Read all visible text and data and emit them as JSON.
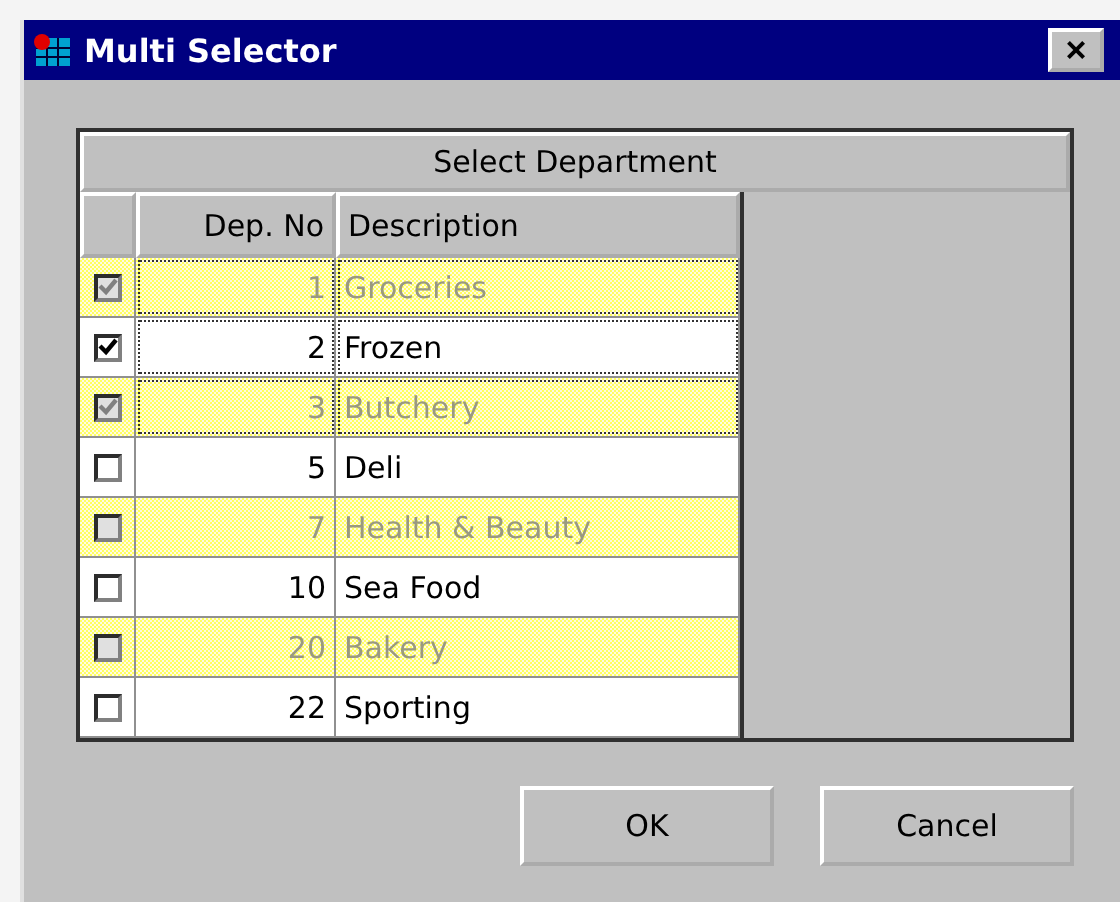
{
  "window": {
    "title": "Multi Selector",
    "close": "×"
  },
  "grid": {
    "title": "Select Department",
    "columns": [
      "Dep. No",
      "Description"
    ],
    "rows": [
      {
        "checked": true,
        "disabled": true,
        "selected": true,
        "no": "1",
        "description": "Groceries"
      },
      {
        "checked": true,
        "disabled": false,
        "selected": true,
        "no": "2",
        "description": "Frozen"
      },
      {
        "checked": true,
        "disabled": true,
        "selected": true,
        "no": "3",
        "description": "Butchery"
      },
      {
        "checked": false,
        "disabled": false,
        "selected": false,
        "no": "5",
        "description": "Deli"
      },
      {
        "checked": false,
        "disabled": true,
        "selected": false,
        "no": "7",
        "description": "Health & Beauty"
      },
      {
        "checked": false,
        "disabled": false,
        "selected": false,
        "no": "10",
        "description": "Sea Food"
      },
      {
        "checked": false,
        "disabled": true,
        "selected": false,
        "no": "20",
        "description": "Bakery"
      },
      {
        "checked": false,
        "disabled": false,
        "selected": false,
        "no": "22",
        "description": "Sporting"
      }
    ]
  },
  "buttons": [
    "OK",
    "Cancel"
  ]
}
